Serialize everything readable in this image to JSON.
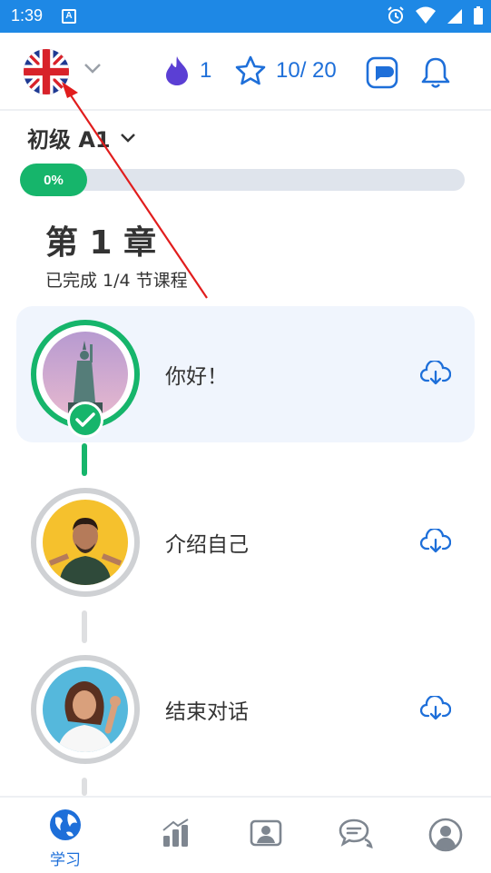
{
  "status_bar": {
    "time": "1:39",
    "app_badge": "A"
  },
  "header": {
    "streak_count": "1",
    "stars_text": "10/ 20"
  },
  "level": {
    "label": "初级 A1"
  },
  "progress": {
    "text": "0%",
    "value": 0
  },
  "chapter": {
    "title": "第 1 章",
    "subtitle": "已完成 1/4 节课程"
  },
  "lessons": [
    {
      "title": "你好！",
      "completed": true
    },
    {
      "title": "介绍自己",
      "completed": false
    },
    {
      "title": "结束对话",
      "completed": false
    }
  ],
  "bottom_nav": [
    {
      "icon": "globe-icon",
      "label": "学习",
      "active": true
    },
    {
      "icon": "stats-icon",
      "label": "",
      "active": false
    },
    {
      "icon": "contact-card-icon",
      "label": "",
      "active": false
    },
    {
      "icon": "chat-bubbles-icon",
      "label": "",
      "active": false
    },
    {
      "icon": "profile-icon",
      "label": "",
      "active": false
    }
  ],
  "colors": {
    "status_bar": "#1e88e5",
    "accent_blue": "#1e6fd9",
    "success_green": "#16b56b",
    "track_gray": "#dfe4ec",
    "annotation_red": "#e11d1d"
  }
}
